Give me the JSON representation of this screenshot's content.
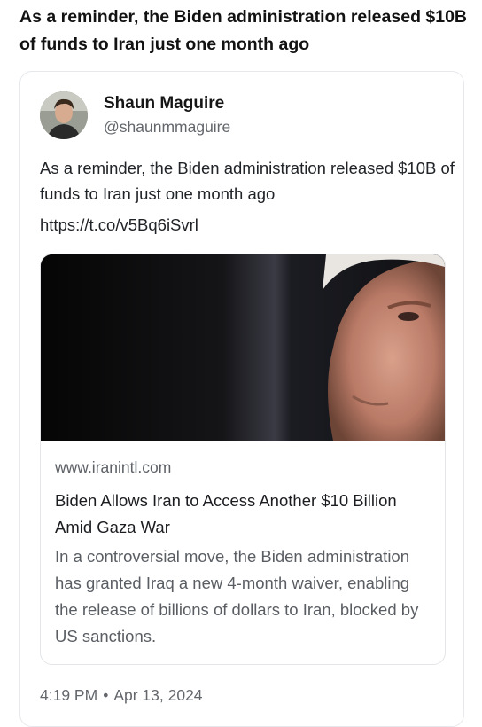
{
  "headline": "As a reminder, the Biden administration released $10B of funds to Iran just one month ago",
  "tweet": {
    "author_name": "Shaun Maguire",
    "author_handle": "@shaunmmaguire",
    "text": "As a reminder, the Biden administration released $10B of funds to Iran just one month ago",
    "link": "https://t.co/v5Bq6iSvrl",
    "time": "4:19 PM",
    "separator": "•",
    "date": "Apr 13, 2024"
  },
  "link_card": {
    "domain": "www.iranintl.com",
    "title": "Biden Allows Iran to Access Another $10 Billion Amid Gaza War",
    "description": "In a controversial move, the Biden administration has granted Iraq a new 4-month waiver, enabling the release of billions of dollars to Iran, blocked by US sanctions."
  }
}
